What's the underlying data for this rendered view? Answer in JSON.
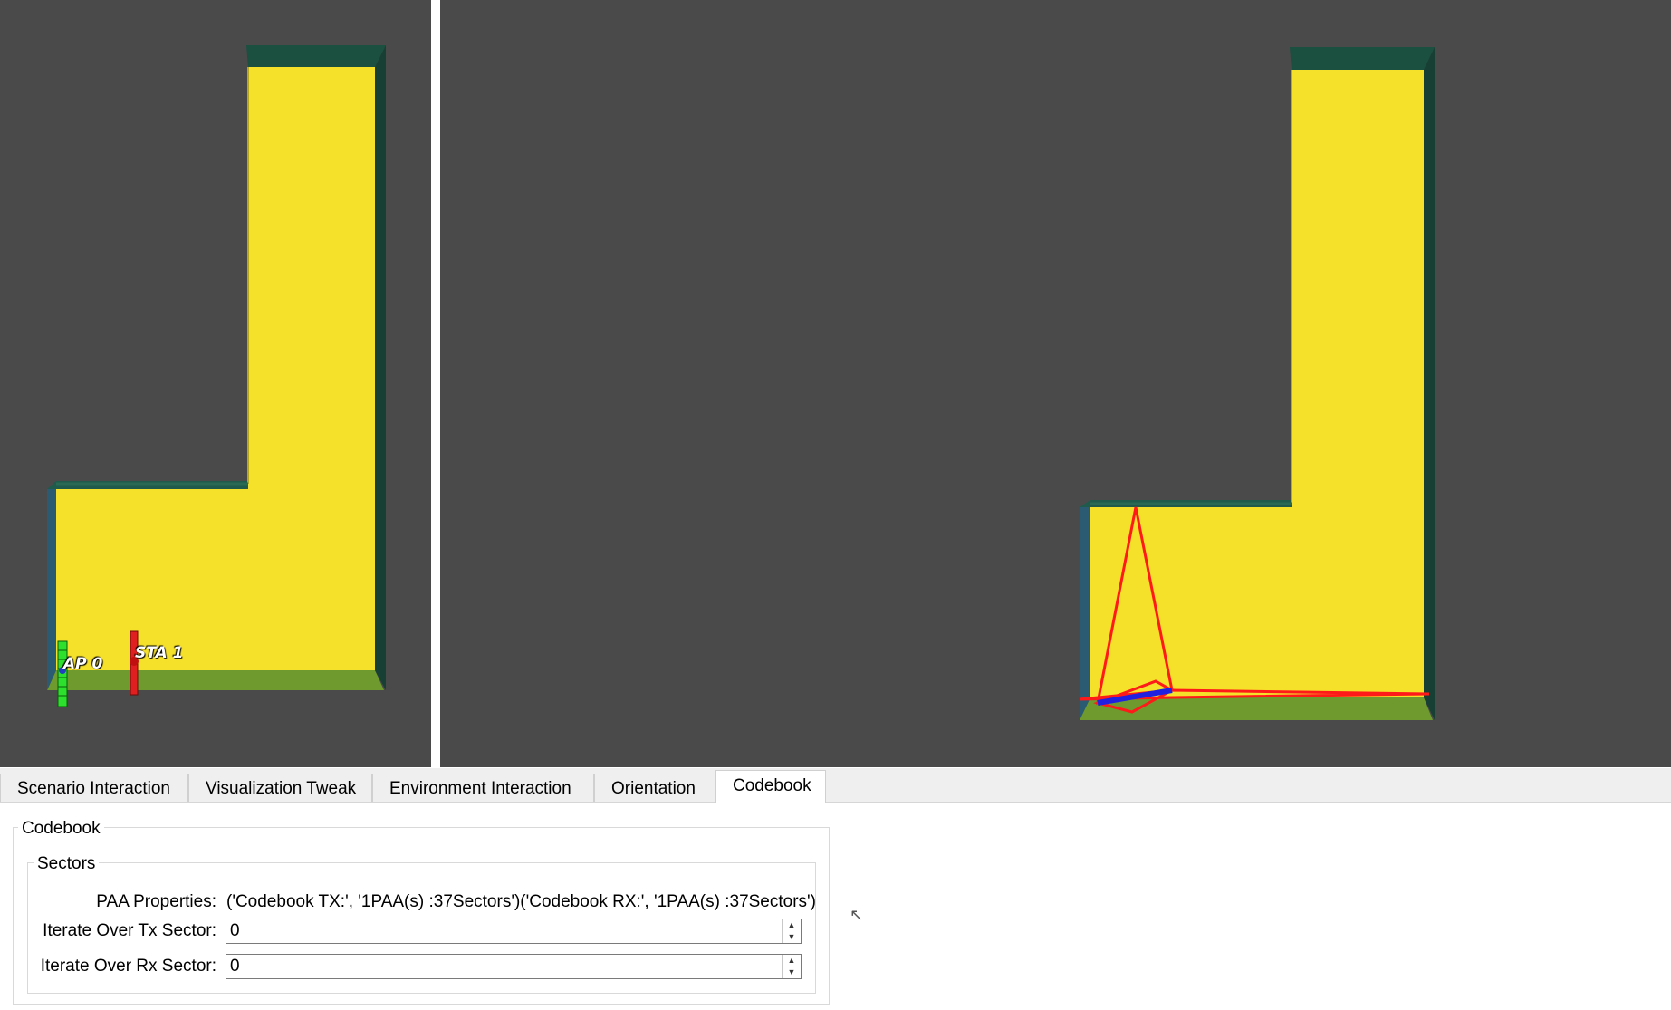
{
  "viewport": {
    "left_labels": {
      "ap": "AP 0",
      "sta": "STA 1"
    }
  },
  "colors": {
    "background": "#4a4a4a",
    "floor": "#f5e02a",
    "wall_dark": "#1b4f3f",
    "wall_blue": "#2a5b73",
    "ground_green": "#6e9a2e",
    "ap_color": "#2ee02e",
    "sta_color": "#e02020",
    "beam_red": "#ff1a1a",
    "beam_blue": "#2020e0"
  },
  "tabs": [
    {
      "label": "Scenario Interaction",
      "active": false
    },
    {
      "label": "Visualization Tweak",
      "active": false
    },
    {
      "label": "Environment Interaction",
      "active": false
    },
    {
      "label": "Orientation",
      "active": false
    },
    {
      "label": "Codebook",
      "active": true
    }
  ],
  "codebook": {
    "group_title": "Codebook",
    "sectors": {
      "title": "Sectors",
      "paa_label": "PAA Properties:",
      "paa_value": "('Codebook TX:', '1PAA(s) :37Sectors')('Codebook RX:', '1PAA(s) :37Sectors')",
      "tx_label": "Iterate Over Tx Sector:",
      "tx_value": "0",
      "rx_label": "Iterate Over Rx Sector:",
      "rx_value": "0"
    }
  },
  "icons": {
    "spin_up": "▲",
    "spin_down": "▼",
    "cursor": "⇱"
  }
}
